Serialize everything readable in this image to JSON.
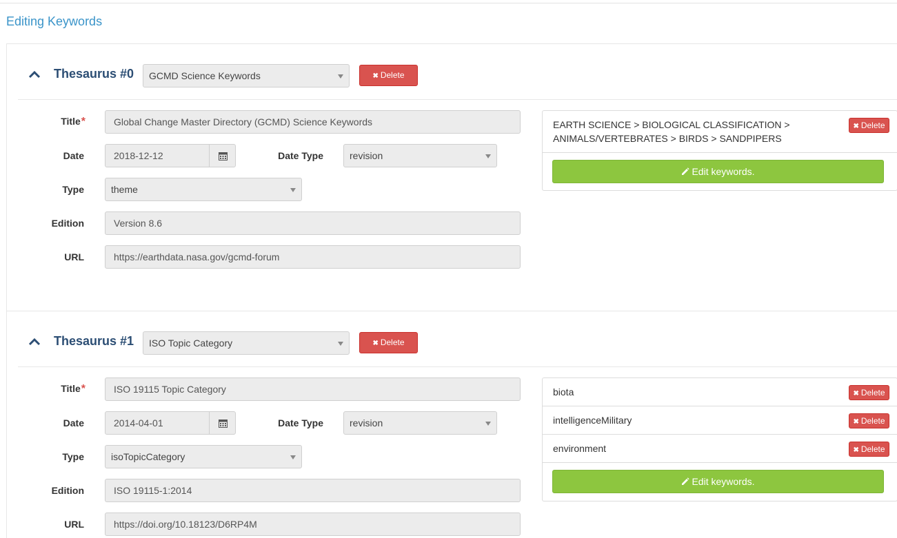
{
  "page": {
    "title": "Editing Keywords"
  },
  "labels": {
    "title": "Title",
    "required_mark": "*",
    "date": "Date",
    "date_type": "Date Type",
    "type": "Type",
    "edition": "Edition",
    "url": "URL",
    "delete": "Delete",
    "edit_keywords": "Edit keywords."
  },
  "colors": {
    "link_blue": "#3a94c9",
    "heading_navy": "#2c4e74",
    "danger": "#d9534f",
    "success": "#8dc63f"
  },
  "thesauri": [
    {
      "heading": "Thesaurus #0",
      "thesaurus_select": "GCMD Science Keywords",
      "title": "Global Change Master Directory (GCMD) Science Keywords",
      "date": "2018-12-12",
      "date_type": "revision",
      "type": "theme",
      "edition": "Version 8.6",
      "url": "https://earthdata.nasa.gov/gcmd-forum",
      "keywords": [
        {
          "line1": "EARTH SCIENCE > BIOLOGICAL CLASSIFICATION >",
          "line2": "ANIMALS/VERTEBRATES > BIRDS > SANDPIPERS"
        }
      ]
    },
    {
      "heading": "Thesaurus #1",
      "thesaurus_select": "ISO Topic Category",
      "title": "ISO 19115 Topic Category",
      "date": "2014-04-01",
      "date_type": "revision",
      "type": "isoTopicCategory",
      "edition": "ISO 19115-1:2014",
      "url": "https://doi.org/10.18123/D6RP4M",
      "keywords": [
        {
          "text": "biota"
        },
        {
          "text": "intelligenceMilitary"
        },
        {
          "text": "environment"
        }
      ]
    }
  ]
}
